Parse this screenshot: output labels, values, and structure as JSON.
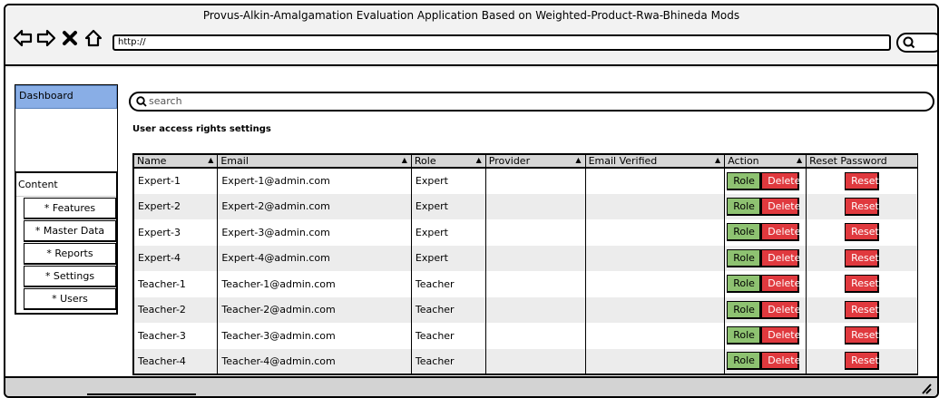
{
  "window": {
    "title": "Provus-Alkin-Amalgamation Evaluation Application Based on Weighted-Product-Rwa-Bhineda Mods"
  },
  "browser": {
    "url": "http://",
    "nav_icons": [
      "back-arrow-icon",
      "forward-arrow-icon",
      "close-x-icon",
      "home-icon"
    ],
    "search_icon": "search-icon"
  },
  "sidebar": {
    "dashboard_label": "Dashboard",
    "content_label": "Content",
    "items": [
      {
        "label": "* Features"
      },
      {
        "label": "* Master Data"
      },
      {
        "label": "* Reports"
      },
      {
        "label": "* Settings"
      },
      {
        "label": "* Users"
      }
    ],
    "active_color": "#89aee6"
  },
  "main": {
    "search_placeholder": "search",
    "section_title": "User access rights settings",
    "table": {
      "headers": [
        "Name",
        "Email",
        "Role",
        "Provider",
        "Email Verified",
        "Action",
        "Reset Password"
      ],
      "sortable": [
        true,
        true,
        true,
        true,
        true,
        true,
        false
      ],
      "rows": [
        {
          "name": "Expert-1",
          "email": "Expert-1@admin.com",
          "role": "Expert",
          "provider": "",
          "email_verified": ""
        },
        {
          "name": "Expert-2",
          "email": "Expert-2@admin.com",
          "role": "Expert",
          "provider": "",
          "email_verified": ""
        },
        {
          "name": "Expert-3",
          "email": "Expert-3@admin.com",
          "role": "Expert",
          "provider": "",
          "email_verified": ""
        },
        {
          "name": "Expert-4",
          "email": "Expert-4@admin.com",
          "role": "Expert",
          "provider": "",
          "email_verified": ""
        },
        {
          "name": "Teacher-1",
          "email": "Teacher-1@admin.com",
          "role": "Teacher",
          "provider": "",
          "email_verified": ""
        },
        {
          "name": "Teacher-2",
          "email": "Teacher-2@admin.com",
          "role": "Teacher",
          "provider": "",
          "email_verified": ""
        },
        {
          "name": "Teacher-3",
          "email": "Teacher-3@admin.com",
          "role": "Teacher",
          "provider": "",
          "email_verified": ""
        },
        {
          "name": "Teacher-4",
          "email": "Teacher-4@admin.com",
          "role": "Teacher",
          "provider": "",
          "email_verified": ""
        }
      ],
      "actions": {
        "role_label": "Role",
        "delete_label": "Delete",
        "reset_label": "Reset"
      }
    }
  },
  "colors": {
    "role_button": "#8ec271",
    "delete_button": "#e0393e",
    "reset_button": "#e0393e",
    "header_bg": "#d6d6d6",
    "alt_row_bg": "#ececec"
  }
}
